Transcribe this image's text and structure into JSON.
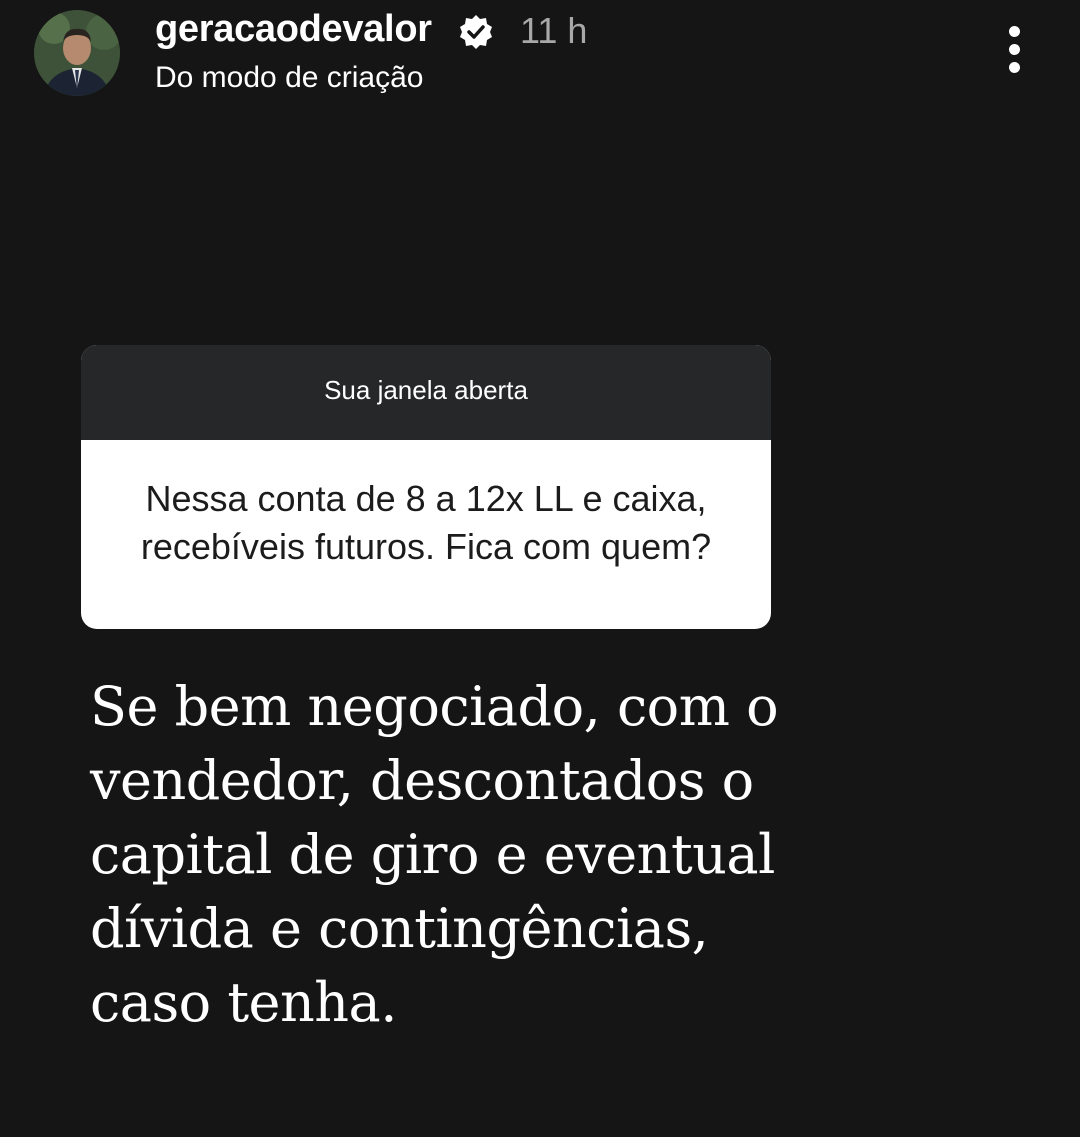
{
  "header": {
    "username": "geracaodevalor",
    "verified_icon": "verified-badge-icon",
    "time": "11 h",
    "subtitle": "Do modo de criação",
    "menu_icon": "more-vertical-icon"
  },
  "question_sticker": {
    "title": "Sua janela aberta",
    "question_lines": [
      "Nessa conta de 8 a 12x LL e caixa,",
      "recebíveis futuros. Fica com quem?"
    ]
  },
  "answer": {
    "lines": [
      "Se bem negociado, com o",
      "vendedor, descontados o",
      "capital de giro e eventual",
      "dívida e contingências,",
      "caso tenha."
    ]
  },
  "colors": {
    "background": "#151515",
    "sticker_header": "#262729",
    "sticker_body": "#ffffff",
    "time_text": "#a8a8a8"
  }
}
